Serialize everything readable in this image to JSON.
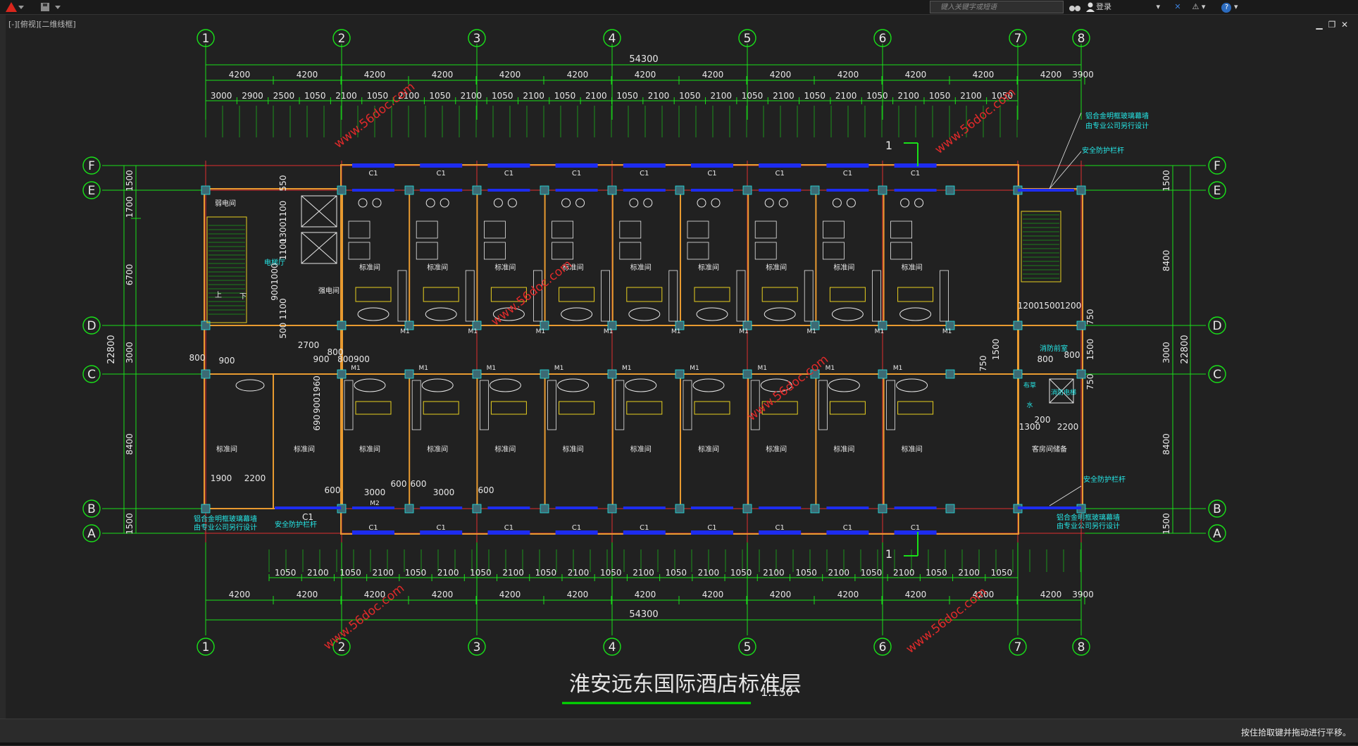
{
  "toolbar": {
    "app_icon": "autocad-logo-icon",
    "search_placeholder": "键入关键字或短语",
    "login_label": "登录"
  },
  "viewport": {
    "label": "[-][俯视][二维线框]"
  },
  "status": {
    "message": "按住拾取键并拖动进行平移。"
  },
  "drawing": {
    "title": "淮安远东国际酒店标准层",
    "scale": "1:150",
    "watermark": "www.56doc.com",
    "total_dim": "54300",
    "height_dim": "22800",
    "grid_x_labels": [
      "1",
      "2",
      "3",
      "4",
      "5",
      "6",
      "7",
      "8"
    ],
    "grid_y_labels": [
      "F",
      "E",
      "D",
      "C",
      "B",
      "A"
    ],
    "top_spacings": [
      "4200",
      "4200",
      "4200",
      "4200",
      "4200",
      "4200",
      "4200",
      "4200",
      "4200",
      "4200",
      "4200",
      "4200",
      "4200",
      "3900"
    ],
    "top_sub_dims": [
      "3000",
      "2900",
      "2500",
      "1050",
      "2100",
      "1050",
      "2100",
      "1050",
      "2100",
      "1050",
      "2100",
      "1050",
      "2100",
      "1050",
      "2100",
      "1050",
      "2100",
      "1050",
      "2100",
      "1050",
      "2100",
      "1050",
      "2100",
      "1050",
      "2100",
      "1050"
    ],
    "bottom_sub_dims": [
      "1050",
      "2100",
      "1050",
      "2100",
      "1050",
      "2100",
      "1050",
      "2100",
      "1050",
      "2100",
      "1050",
      "2100",
      "1050",
      "2100",
      "1050",
      "2100",
      "1050",
      "2100",
      "1050",
      "2100",
      "1050",
      "2100",
      "1050"
    ],
    "bottom_spacings": [
      "4200",
      "4200",
      "4200",
      "4200",
      "4200",
      "4200",
      "4200",
      "4200",
      "4200",
      "4200",
      "4200",
      "4200",
      "4200",
      "3900"
    ],
    "left_dims": [
      "1500",
      "1700",
      "6700",
      "3000",
      "8400",
      "1500"
    ],
    "right_dims": [
      "1500",
      "8400",
      "3000",
      "8400",
      "1500"
    ],
    "room_label": "标准间",
    "suite_label": "客房间储备",
    "window_tag": "C1",
    "door_tag": "M1",
    "door2_tag": "M2",
    "section_mark": "1",
    "note_curtain": "铝合金明框玻璃幕墙",
    "note_curtain2": "由专业公司另行设计",
    "note_railing": "安全防护栏杆",
    "labels": {
      "weak_room": "弱电间",
      "strong_room": "强电间",
      "elevator_hall": "电梯厅",
      "fire_room": "消防前室",
      "fire_elev": "消防电梯",
      "linen": "布草",
      "water": "水",
      "up": "上",
      "down": "下"
    },
    "misc_dims": {
      "d550": "550",
      "d1100": "1100",
      "d1300": "1300",
      "d9001000": "9001000",
      "d5001100": "500 1100",
      "d2700": "2700",
      "d800": "800",
      "d900": "900",
      "d800900": "800900",
      "d9001960": "9001960",
      "d690": "690",
      "d1900": "1900",
      "d2200": "2200",
      "d3000": "3000",
      "d600": "600",
      "d1200": "1200",
      "d1500": "1500",
      "d750": "750",
      "d1300b": "1300",
      "d200": "200"
    }
  }
}
